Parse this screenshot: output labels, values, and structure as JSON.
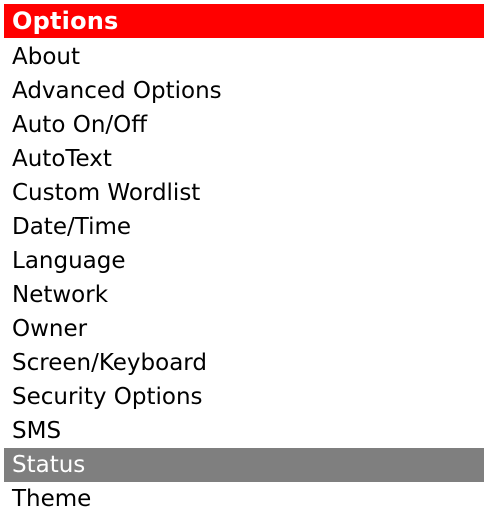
{
  "title": "Options",
  "colors": {
    "title_background": "#ff0000",
    "title_text": "#ffffff",
    "selected_background": "#7f7f7f",
    "selected_text": "#ffffff",
    "item_text": "#000000"
  },
  "items": [
    "About",
    "Advanced Options",
    "Auto On/Off",
    "AutoText",
    "Custom Wordlist",
    "Date/Time",
    "Language",
    "Network",
    "Owner",
    "Screen/Keyboard",
    "Security Options",
    "SMS",
    "Status",
    "Theme"
  ],
  "selected_item": "Status"
}
